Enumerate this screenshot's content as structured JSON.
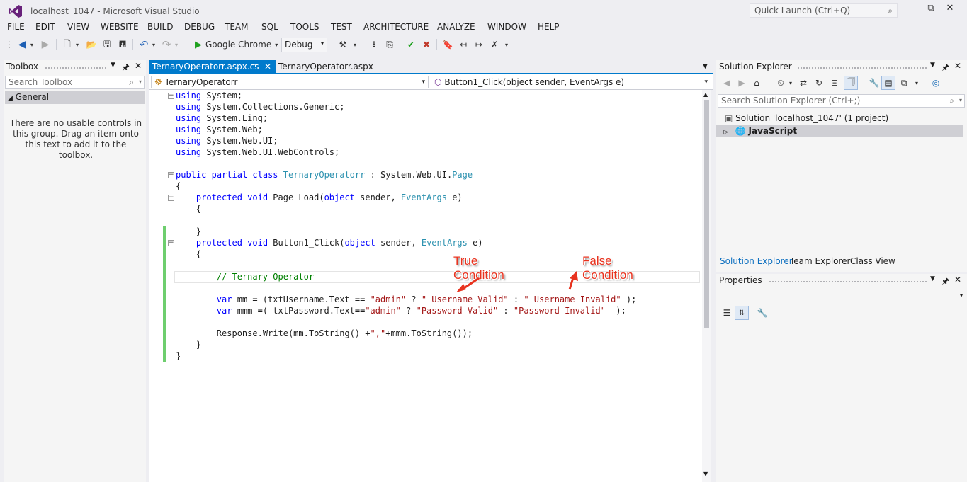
{
  "window": {
    "title": "localhost_1047 - Microsoft Visual Studio",
    "quick_launch_placeholder": "Quick Launch (Ctrl+Q)"
  },
  "menu": [
    "FILE",
    "EDIT",
    "VIEW",
    "WEBSITE",
    "BUILD",
    "DEBUG",
    "TEAM",
    "SQL",
    "TOOLS",
    "TEST",
    "ARCHITECTURE",
    "ANALYZE",
    "WINDOW",
    "HELP"
  ],
  "toolbar": {
    "run_target": "Google Chrome",
    "configuration": "Debug"
  },
  "toolbox": {
    "title": "Toolbox",
    "search_placeholder": "Search Toolbox",
    "group": "General",
    "empty_message": "There are no usable controls in this group. Drag an item onto this text to add it to the toolbox."
  },
  "editor": {
    "tabs": [
      {
        "label": "TernaryOperatorr.aspx.cs",
        "active": true
      },
      {
        "label": "TernaryOperatorr.aspx",
        "active": false
      }
    ],
    "nav_class": "TernaryOperatorr",
    "nav_member": "Button1_Click(object sender, EventArgs e)",
    "code": [
      [
        "using System;"
      ],
      [
        "using System.Collections.Generic;"
      ],
      [
        "using System.Linq;"
      ],
      [
        "using System.Web;"
      ],
      [
        "using System.Web.UI;"
      ],
      [
        "using System.Web.UI.WebControls;"
      ],
      [
        ""
      ],
      [
        "public partial class TernaryOperatorr : System.Web.UI.Page"
      ],
      [
        "{"
      ],
      [
        "    protected void Page_Load(object sender, EventArgs e)"
      ],
      [
        "    {"
      ],
      [
        ""
      ],
      [
        "    }"
      ],
      [
        "    protected void Button1_Click(object sender, EventArgs e)"
      ],
      [
        "    {"
      ],
      [
        ""
      ],
      [
        "        // Ternary Operator"
      ],
      [
        ""
      ],
      [
        "        var mm = (txtUsername.Text == \"admin\" ? \" Username Valid\" : \" Username Invalid\" );"
      ],
      [
        "        var mmm =( txtPassword.Text==\"admin\" ? \"Password Valid\" : \"Password Invalid\"  );"
      ],
      [
        ""
      ],
      [
        "        Response.Write(mm.ToString() +\",\"+mmm.ToString());"
      ],
      [
        "    }"
      ],
      [
        "}"
      ]
    ],
    "annotations": {
      "true_label_1": "True",
      "true_label_2": "Condition",
      "false_label_1": "False",
      "false_label_2": "Condition"
    }
  },
  "solution_explorer": {
    "title": "Solution Explorer",
    "search_placeholder": "Search Solution Explorer (Ctrl+;)",
    "solution": "Solution 'localhost_1047' (1 project)",
    "project": "JavaScript",
    "tabs": [
      "Solution Explorer",
      "Team Explorer",
      "Class View"
    ]
  },
  "properties": {
    "title": "Properties"
  }
}
